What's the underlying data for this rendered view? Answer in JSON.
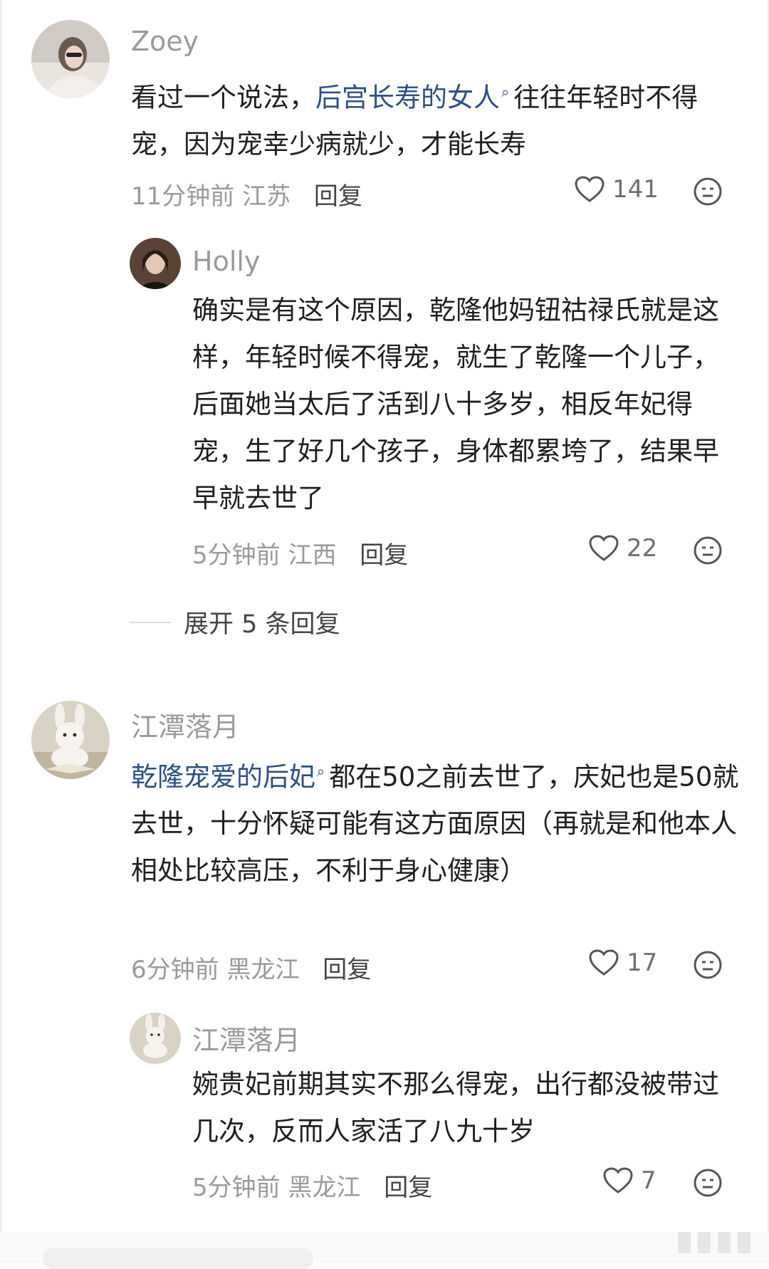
{
  "comments": [
    {
      "name": "Zoey",
      "text_prefix": "看过一个说法，",
      "link": "后宫长寿的女人",
      "text_suffix": "往往年轻时不得宠，因为宠幸少病就少，才能长寿",
      "time": "11分钟前",
      "location": "江苏",
      "reply": "回复",
      "likes": "141",
      "reply_thread": {
        "name": "Holly",
        "text": "确实是有这个原因，乾隆他妈钮祜禄氏就是这样，年轻时候不得宠，就生了乾隆一个儿子，后面她当太后了活到八十多岁，相反年妃得宠，生了好几个孩子，身体都累垮了，结果早早就去世了",
        "time": "5分钟前",
        "location": "江西",
        "reply": "回复",
        "likes": "22"
      },
      "expand": "展开 5 条回复"
    },
    {
      "name": "江潭落月",
      "link": "乾隆宠爱的后妃",
      "text_suffix": "都在50之前去世了，庆妃也是50就去世，十分怀疑可能有这方面原因（再就是和他本人相处比较高压，不利于身心健康）",
      "time": "6分钟前",
      "location": "黑龙江",
      "reply": "回复",
      "likes": "17",
      "reply_thread": {
        "name": "江潭落月",
        "text": "婉贵妃前期其实不那么得宠，出行都没被带过几次，反而人家活了八九十岁",
        "time": "5分钟前",
        "location": "黑龙江",
        "reply": "回复",
        "likes": "7"
      }
    }
  ],
  "icons": {
    "heart": "heart-icon",
    "reaction": "emoji-face-icon",
    "search_link": "magnifier-icon"
  },
  "colors": {
    "link": "#2d4f87",
    "meta": "#9a9a9a",
    "text": "#1f1f1f"
  }
}
